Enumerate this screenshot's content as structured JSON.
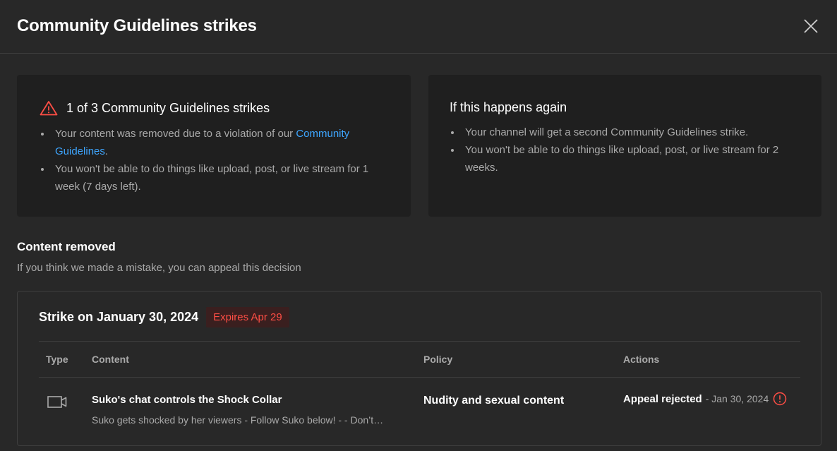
{
  "dialog": {
    "title": "Community Guidelines strikes",
    "close_icon": "close-icon"
  },
  "current_strike_card": {
    "title": "1 of 3 Community Guidelines strikes",
    "icon": "warning-triangle-icon",
    "icon_color": "#ff4e45",
    "bullet1_prefix": "Your content was removed due to a violation of our ",
    "bullet1_link": "Community Guidelines",
    "bullet1_suffix": ".",
    "bullet2": "You won't be able to do things like upload, post, or live stream for 1 week (7 days left)."
  },
  "next_strike_card": {
    "title": "If this happens again",
    "bullet1": "Your channel will get a second Community Guidelines strike.",
    "bullet2": "You won't be able to do things like upload, post, or live stream for 2 weeks."
  },
  "content_removed": {
    "title": "Content removed",
    "subtitle": "If you think we made a mistake, you can appeal this decision"
  },
  "strike": {
    "title": "Strike on January 30, 2024",
    "expires_badge": "Expires Apr 29",
    "badge_color": "#ff4e45",
    "columns": [
      "Type",
      "Content",
      "Policy",
      "Actions"
    ],
    "row": {
      "type_icon": "video-camera-icon",
      "content_title": "Suko's chat controls the Shock Collar",
      "content_desc": "Suko gets shocked by her viewers - Follow Suko below! - - Don’t…",
      "policy": "Nudity and sexual content",
      "action_status": "Appeal rejected",
      "action_date": "- Jan 30, 2024",
      "info_icon": "info-icon"
    }
  },
  "colors": {
    "background": "#282828",
    "card": "#1f1f1f",
    "link": "#3ea6ff",
    "secondary_text": "#aaaaaa"
  }
}
